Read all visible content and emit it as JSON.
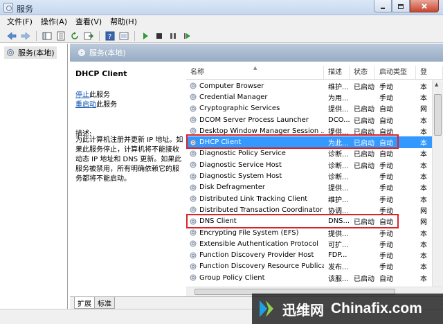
{
  "window": {
    "title": "服务"
  },
  "menubar": {
    "items": [
      "文件(F)",
      "操作(A)",
      "查看(V)",
      "帮助(H)"
    ]
  },
  "tree": {
    "root_label": "服务(本地)"
  },
  "pane": {
    "header": "服务(本地)"
  },
  "description": {
    "service_name": "DHCP Client",
    "stop_link": "停止",
    "stop_suffix": "此服务",
    "restart_link": "重启动",
    "restart_suffix": "此服务",
    "label": "描述:",
    "text": "为此计算机注册并更新 IP 地址。如果此服务停止，计算机将不能接收动态 IP 地址和 DNS 更新。如果此服务被禁用，所有明确依赖它的服务都将不能启动。"
  },
  "list": {
    "columns": [
      "名称",
      "描述",
      "状态",
      "启动类型",
      "登"
    ],
    "rows": [
      {
        "name": "Computer Browser",
        "desc": "维护...",
        "status": "已启动",
        "startup": "手动",
        "logon": "本"
      },
      {
        "name": "Credential Manager",
        "desc": "为用...",
        "status": "",
        "startup": "手动",
        "logon": "本"
      },
      {
        "name": "Cryptographic Services",
        "desc": "提供...",
        "status": "已启动",
        "startup": "自动",
        "logon": "网"
      },
      {
        "name": "DCOM Server Process Launcher",
        "desc": "DCO...",
        "status": "已启动",
        "startup": "自动",
        "logon": "本"
      },
      {
        "name": "Desktop Window Manager Session ...",
        "desc": "提供...",
        "status": "已启动",
        "startup": "自动",
        "logon": "本"
      },
      {
        "name": "DHCP Client",
        "desc": "为此...",
        "status": "已启动",
        "startup": "自动",
        "logon": "本"
      },
      {
        "name": "Diagnostic Policy Service",
        "desc": "诊断...",
        "status": "已启动",
        "startup": "自动",
        "logon": "本"
      },
      {
        "name": "Diagnostic Service Host",
        "desc": "诊断...",
        "status": "已启动",
        "startup": "手动",
        "logon": "本"
      },
      {
        "name": "Diagnostic System Host",
        "desc": "诊断...",
        "status": "",
        "startup": "手动",
        "logon": "本"
      },
      {
        "name": "Disk Defragmenter",
        "desc": "提供...",
        "status": "",
        "startup": "手动",
        "logon": "本"
      },
      {
        "name": "Distributed Link Tracking Client",
        "desc": "维护...",
        "status": "",
        "startup": "手动",
        "logon": "本"
      },
      {
        "name": "Distributed Transaction Coordinator",
        "desc": "协调...",
        "status": "",
        "startup": "手动",
        "logon": "网"
      },
      {
        "name": "DNS Client",
        "desc": "DNS...",
        "status": "已启动",
        "startup": "自动",
        "logon": "网"
      },
      {
        "name": "Encrypting File System (EFS)",
        "desc": "提供...",
        "status": "",
        "startup": "手动",
        "logon": "本"
      },
      {
        "name": "Extensible Authentication Protocol",
        "desc": "可扩...",
        "status": "",
        "startup": "手动",
        "logon": "本"
      },
      {
        "name": "Function Discovery Provider Host",
        "desc": "FDP...",
        "status": "",
        "startup": "手动",
        "logon": "本"
      },
      {
        "name": "Function Discovery Resource Publicati...",
        "desc": "发布...",
        "status": "",
        "startup": "手动",
        "logon": "本"
      },
      {
        "name": "Group Policy Client",
        "desc": "该服...",
        "status": "已启动",
        "startup": "自动",
        "logon": "本"
      }
    ]
  },
  "tabs": [
    "扩展",
    "标准"
  ],
  "watermark": {
    "cn": "迅维网",
    "en": "Chinafix.com"
  },
  "colors": {
    "selection": "#3399ff",
    "highlight": "#d9232b",
    "link": "#0b4fb1"
  }
}
